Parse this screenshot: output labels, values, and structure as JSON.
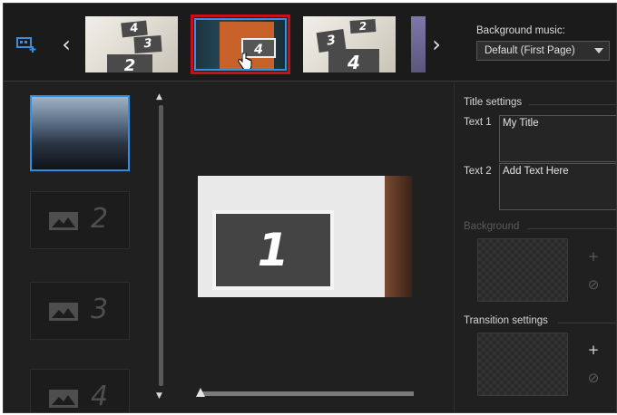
{
  "topbar": {
    "add_photo_icon": "add-photo-icon",
    "prev_arrow": "‹",
    "next_arrow": "›",
    "thumbnails": [
      {
        "labels": [
          "4",
          "3",
          "2"
        ],
        "selected": false
      },
      {
        "labels": [
          "4"
        ],
        "selected": true
      },
      {
        "labels": [
          "2",
          "3",
          "4"
        ],
        "selected": false
      },
      {
        "labels": [],
        "selected": false
      }
    ],
    "background_music_label": "Background music:",
    "background_music_value": "Default (First Page)"
  },
  "slides": [
    {
      "number": "",
      "selected": true
    },
    {
      "number": "2",
      "selected": false
    },
    {
      "number": "3",
      "selected": false
    },
    {
      "number": "4",
      "selected": false
    }
  ],
  "scrollbar": {
    "up": "▲",
    "down": "▼"
  },
  "preview": {
    "frame_number": "1"
  },
  "settings": {
    "title_settings": "Title settings",
    "text1_label": "Text 1",
    "text1_value": "My Title",
    "text2_label": "Text 2",
    "text2_value": "Add Text Here",
    "background_label": "Background",
    "transition_settings": "Transition settings",
    "add_symbol": "+",
    "remove_symbol": "⊘"
  },
  "colors": {
    "selection_blue": "#2f8fe6",
    "highlight_red": "#c8101c",
    "panel_bg": "#202020"
  }
}
